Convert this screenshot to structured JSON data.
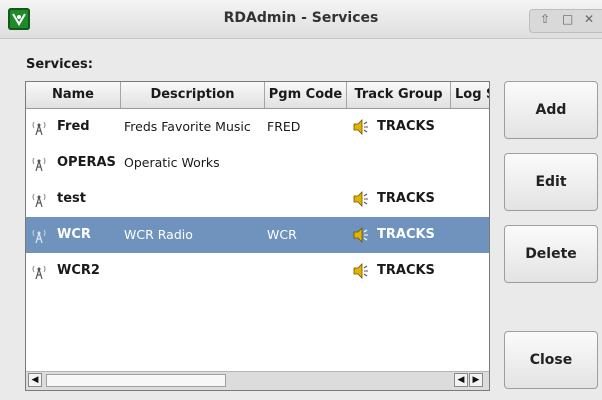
{
  "window": {
    "title": "RDAdmin - Services",
    "controls": [
      "restore-icon",
      "maximize-icon",
      "close-icon"
    ]
  },
  "services_label": "Services:",
  "columns": [
    "Name",
    "Description",
    "Pgm Code",
    "Track Group",
    "Log S"
  ],
  "rows": [
    {
      "name": "Fred",
      "description": "Freds Favorite Music",
      "pgm_code": "FRED",
      "track_group": "TRACKS",
      "selected": false
    },
    {
      "name": "OPERAS",
      "description": "Operatic Works",
      "pgm_code": "",
      "track_group": "",
      "selected": false
    },
    {
      "name": "test",
      "description": "",
      "pgm_code": "",
      "track_group": "TRACKS",
      "selected": false
    },
    {
      "name": "WCR",
      "description": "WCR Radio",
      "pgm_code": "WCR",
      "track_group": "TRACKS",
      "selected": true
    },
    {
      "name": "WCR2",
      "description": "",
      "pgm_code": "",
      "track_group": "TRACKS",
      "selected": false
    }
  ],
  "buttons": {
    "add": "Add",
    "edit": "Edit",
    "delete": "Delete",
    "close": "Close"
  },
  "colors": {
    "selection": "#6f93bd",
    "app_icon": "#1f8a2a"
  }
}
